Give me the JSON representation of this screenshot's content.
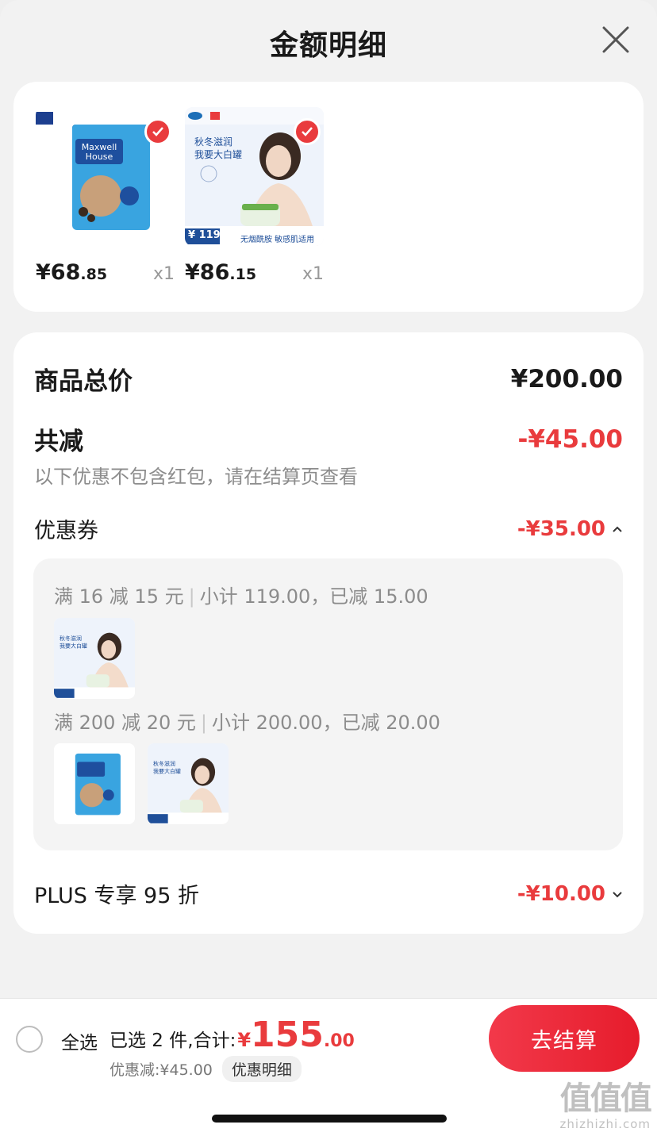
{
  "header": {
    "title": "金额明细"
  },
  "products": [
    {
      "price_int": "¥68",
      "price_dec": ".85",
      "qty": "x1",
      "thumb": "maxwell-house-coffee-image"
    },
    {
      "price_int": "¥86",
      "price_dec": ".15",
      "qty": "x1",
      "thumb": "cetaphil-cream-ad-image",
      "badge_price": "¥ 119",
      "badge_text": "无烟酰胺 敏感肌适用"
    }
  ],
  "summary": {
    "total_label": "商品总价",
    "total_value": "¥200.00",
    "reduce_label": "共减",
    "reduce_value": "-¥45.00",
    "note": "以下优惠不包含红包，请在结算页查看",
    "coupon_label": "优惠券",
    "coupon_value": "-¥35.00",
    "plus_label": "PLUS 专享 95 折",
    "plus_value": "-¥10.00"
  },
  "coupon_rules": [
    {
      "rule": "满 16 减 15 元",
      "detail": "小计 119.00，已减 15.00"
    },
    {
      "rule": "满 200 减 20 元",
      "detail": "小计 200.00，已减 20.00"
    }
  ],
  "bottom": {
    "select_all": "全选",
    "selected_text": "已选 2 件,合计:",
    "total_symbol": "¥",
    "total_int": "155",
    "total_dec": ".00",
    "discount_text": "优惠减:¥45.00",
    "detail_link": "优惠明细",
    "checkout": "去结算"
  },
  "watermark": {
    "big": "值值值",
    "small": "zhizhizhi.com"
  },
  "colors": {
    "accent_red": "#e93b3d",
    "background": "#f2f2f2"
  }
}
